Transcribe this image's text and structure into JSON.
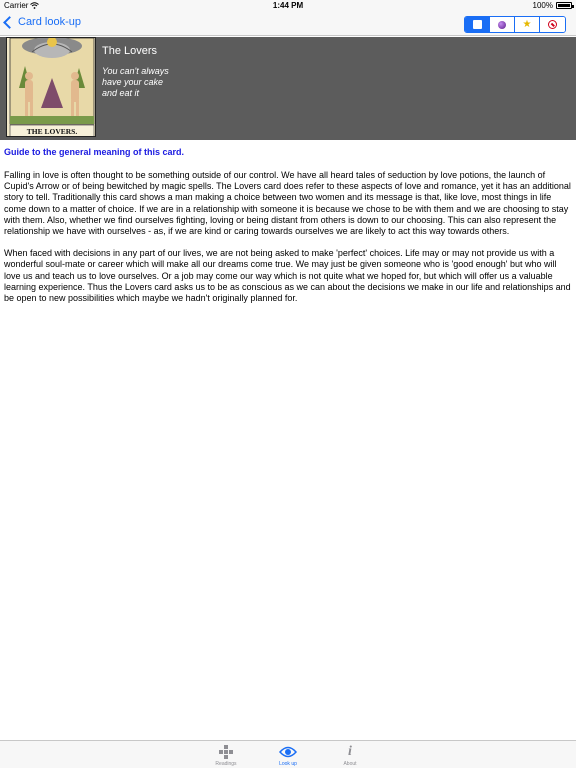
{
  "status_bar": {
    "carrier": "Carrier",
    "time": "1:44 PM",
    "battery": "100%"
  },
  "nav": {
    "back_label": "Card look-up",
    "segments": [
      {
        "name": "square",
        "icon": "square-icon"
      },
      {
        "name": "orb",
        "icon": "orb-icon"
      },
      {
        "name": "star",
        "icon": "star-icon"
      },
      {
        "name": "prohibited",
        "icon": "no-entry-icon"
      }
    ],
    "selected_segment": 0
  },
  "card": {
    "image_caption": "THE LOVERS.",
    "title": "The Lovers",
    "quote": "You can't always\nhave your cake\nand eat it"
  },
  "guide_link": "Guide to the general meaning of this card.",
  "paragraphs": [
    "Falling in love is often thought to be something outside of our control. We have all heard tales of seduction by love potions, the launch of Cupid's Arrow or of being bewitched by magic spells. The Lovers card does refer to these aspects of love and romance, yet it has an additional story to tell. Traditionally this card shows a man making a choice between two women and its message is that, like love, most things in life come down to a matter of choice. If we are in a relationship with someone it is because we chose to be with them and we are choosing to stay with them. Also, whether we find ourselves fighting, loving or being distant from others is down to our choosing. This can also represent the relationship we have with ourselves - as, if we are kind or caring towards ourselves we are likely to act this way towards others.",
    "When faced with decisions in any part of our lives, we are not being asked to make 'perfect' choices. Life may or may not provide us with a wonderful soul-mate or career which will make all our dreams come true. We may just be given someone who is 'good enough' but who will love us and teach us to love ourselves. Or a job may come our way which is not quite what we hoped for, but which will offer us a valuable learning experience. Thus the Lovers card asks us to be as conscious as we can about the decisions we make in our life and relationships and be open to new possibilities which maybe we hadn't originally planned for."
  ],
  "tabs": [
    {
      "label": "Readings",
      "icon": "cards-grid-icon"
    },
    {
      "label": "Look up",
      "icon": "eye-icon"
    },
    {
      "label": "About",
      "icon": "info-icon"
    }
  ],
  "active_tab": 1,
  "colors": {
    "accent": "#1a6ef5",
    "header_bg": "#5c5c5c",
    "link": "#1a1ae0"
  }
}
